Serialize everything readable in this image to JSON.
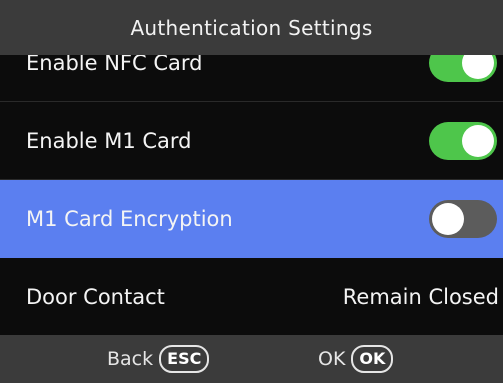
{
  "header": {
    "title": "Authentication Settings"
  },
  "settings": [
    {
      "label": "Enable NFC Card",
      "type": "toggle",
      "enabled": true,
      "selected": false
    },
    {
      "label": "Enable M1 Card",
      "type": "toggle",
      "enabled": true,
      "selected": false
    },
    {
      "label": "M1 Card Encryption",
      "type": "toggle",
      "enabled": false,
      "selected": true
    },
    {
      "label": "Door Contact",
      "type": "value",
      "value": "Remain Closed",
      "selected": false
    }
  ],
  "footer": {
    "back_label": "Back",
    "back_key": "ESC",
    "ok_label": "OK",
    "ok_key": "OK"
  },
  "colors": {
    "selected_row": "#5b7ff0",
    "toggle_on": "#4ec64b",
    "toggle_off": "#5c5c5c",
    "bar_background": "#3b3b3b"
  }
}
